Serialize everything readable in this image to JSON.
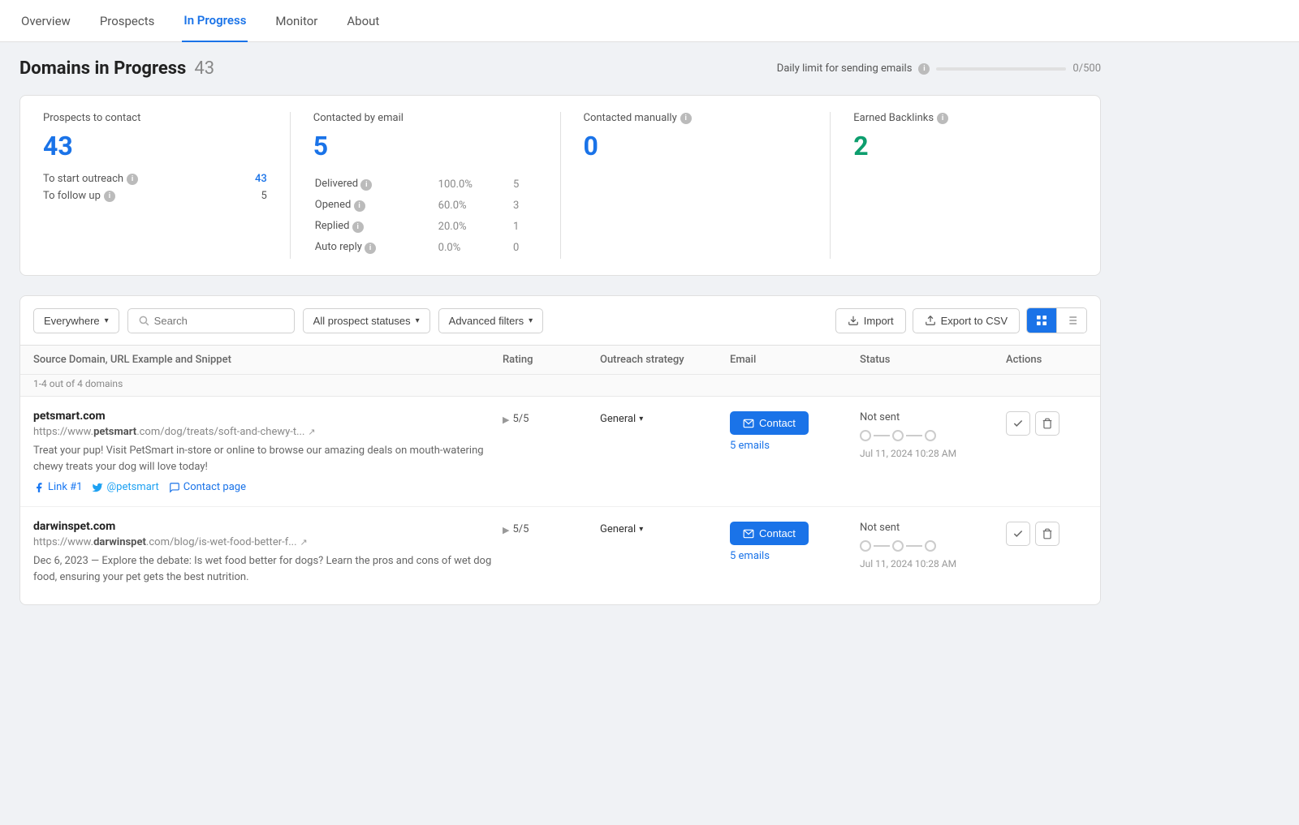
{
  "nav": {
    "items": [
      {
        "label": "Overview",
        "active": false
      },
      {
        "label": "Prospects",
        "active": false
      },
      {
        "label": "In Progress",
        "active": true
      },
      {
        "label": "Monitor",
        "active": false
      },
      {
        "label": "About",
        "active": false
      }
    ]
  },
  "page": {
    "title": "Domains in Progress",
    "count": "43",
    "daily_limit_label": "Daily limit for sending emails",
    "daily_limit_value": "0/500"
  },
  "stats": {
    "prospects": {
      "label": "Prospects to contact",
      "value": "43",
      "rows": [
        {
          "label": "To start outreach",
          "value": "43"
        },
        {
          "label": "To follow up",
          "value": "5"
        }
      ]
    },
    "email": {
      "label": "Contacted by email",
      "value": "5",
      "rows": [
        {
          "label": "Delivered",
          "pct": "100.0%",
          "count": "5"
        },
        {
          "label": "Opened",
          "pct": "60.0%",
          "count": "3"
        },
        {
          "label": "Replied",
          "pct": "20.0%",
          "count": "1"
        },
        {
          "label": "Auto reply",
          "pct": "0.0%",
          "count": "0"
        }
      ]
    },
    "manual": {
      "label": "Contacted manually",
      "value": "0"
    },
    "backlinks": {
      "label": "Earned Backlinks",
      "value": "2"
    }
  },
  "filters": {
    "location": "Everywhere",
    "search_placeholder": "Search",
    "status": "All prospect statuses",
    "advanced": "Advanced filters",
    "import": "Import",
    "export": "Export to CSV"
  },
  "table": {
    "columns": [
      "Source Domain, URL Example and Snippet",
      "Rating",
      "Outreach strategy",
      "Email",
      "Status",
      "Actions"
    ],
    "subheader": "1-4 out of 4 domains",
    "rows": [
      {
        "domain": "petsmart.com",
        "url": "https://www.petsmart.com/dog/treats/soft-and-chewy-t...",
        "url_domain": "petsmart",
        "url_suffix": ".com/dog/treats/soft-and-chewy-t...",
        "snippet": "Treat your pup! Visit PetSmart in-store or online to browse our amazing deals on mouth-watering chewy treats your dog will love today!",
        "links": [
          {
            "icon": "facebook",
            "label": "Link #1"
          },
          {
            "icon": "twitter",
            "label": "@petsmart"
          },
          {
            "icon": "message",
            "label": "Contact page"
          }
        ],
        "rating": "5/5",
        "strategy": "General",
        "email_count": "5 emails",
        "status_label": "Not sent",
        "status_date": "Jul 11, 2024 10:28 AM"
      },
      {
        "domain": "darwinspet.com",
        "url": "https://www.darwinspet.com/blog/is-wet-food-better-f...",
        "url_domain": "darwinspet",
        "url_suffix": ".com/blog/is-wet-food-better-f...",
        "snippet": "Dec 6, 2023 — Explore the debate: Is wet food better for dogs? Learn the pros and cons of wet dog food, ensuring your pet gets the best nutrition.",
        "links": [],
        "rating": "5/5",
        "strategy": "General",
        "email_count": "5 emails",
        "status_label": "Not sent",
        "status_date": "Jul 11, 2024 10:28 AM"
      }
    ]
  }
}
